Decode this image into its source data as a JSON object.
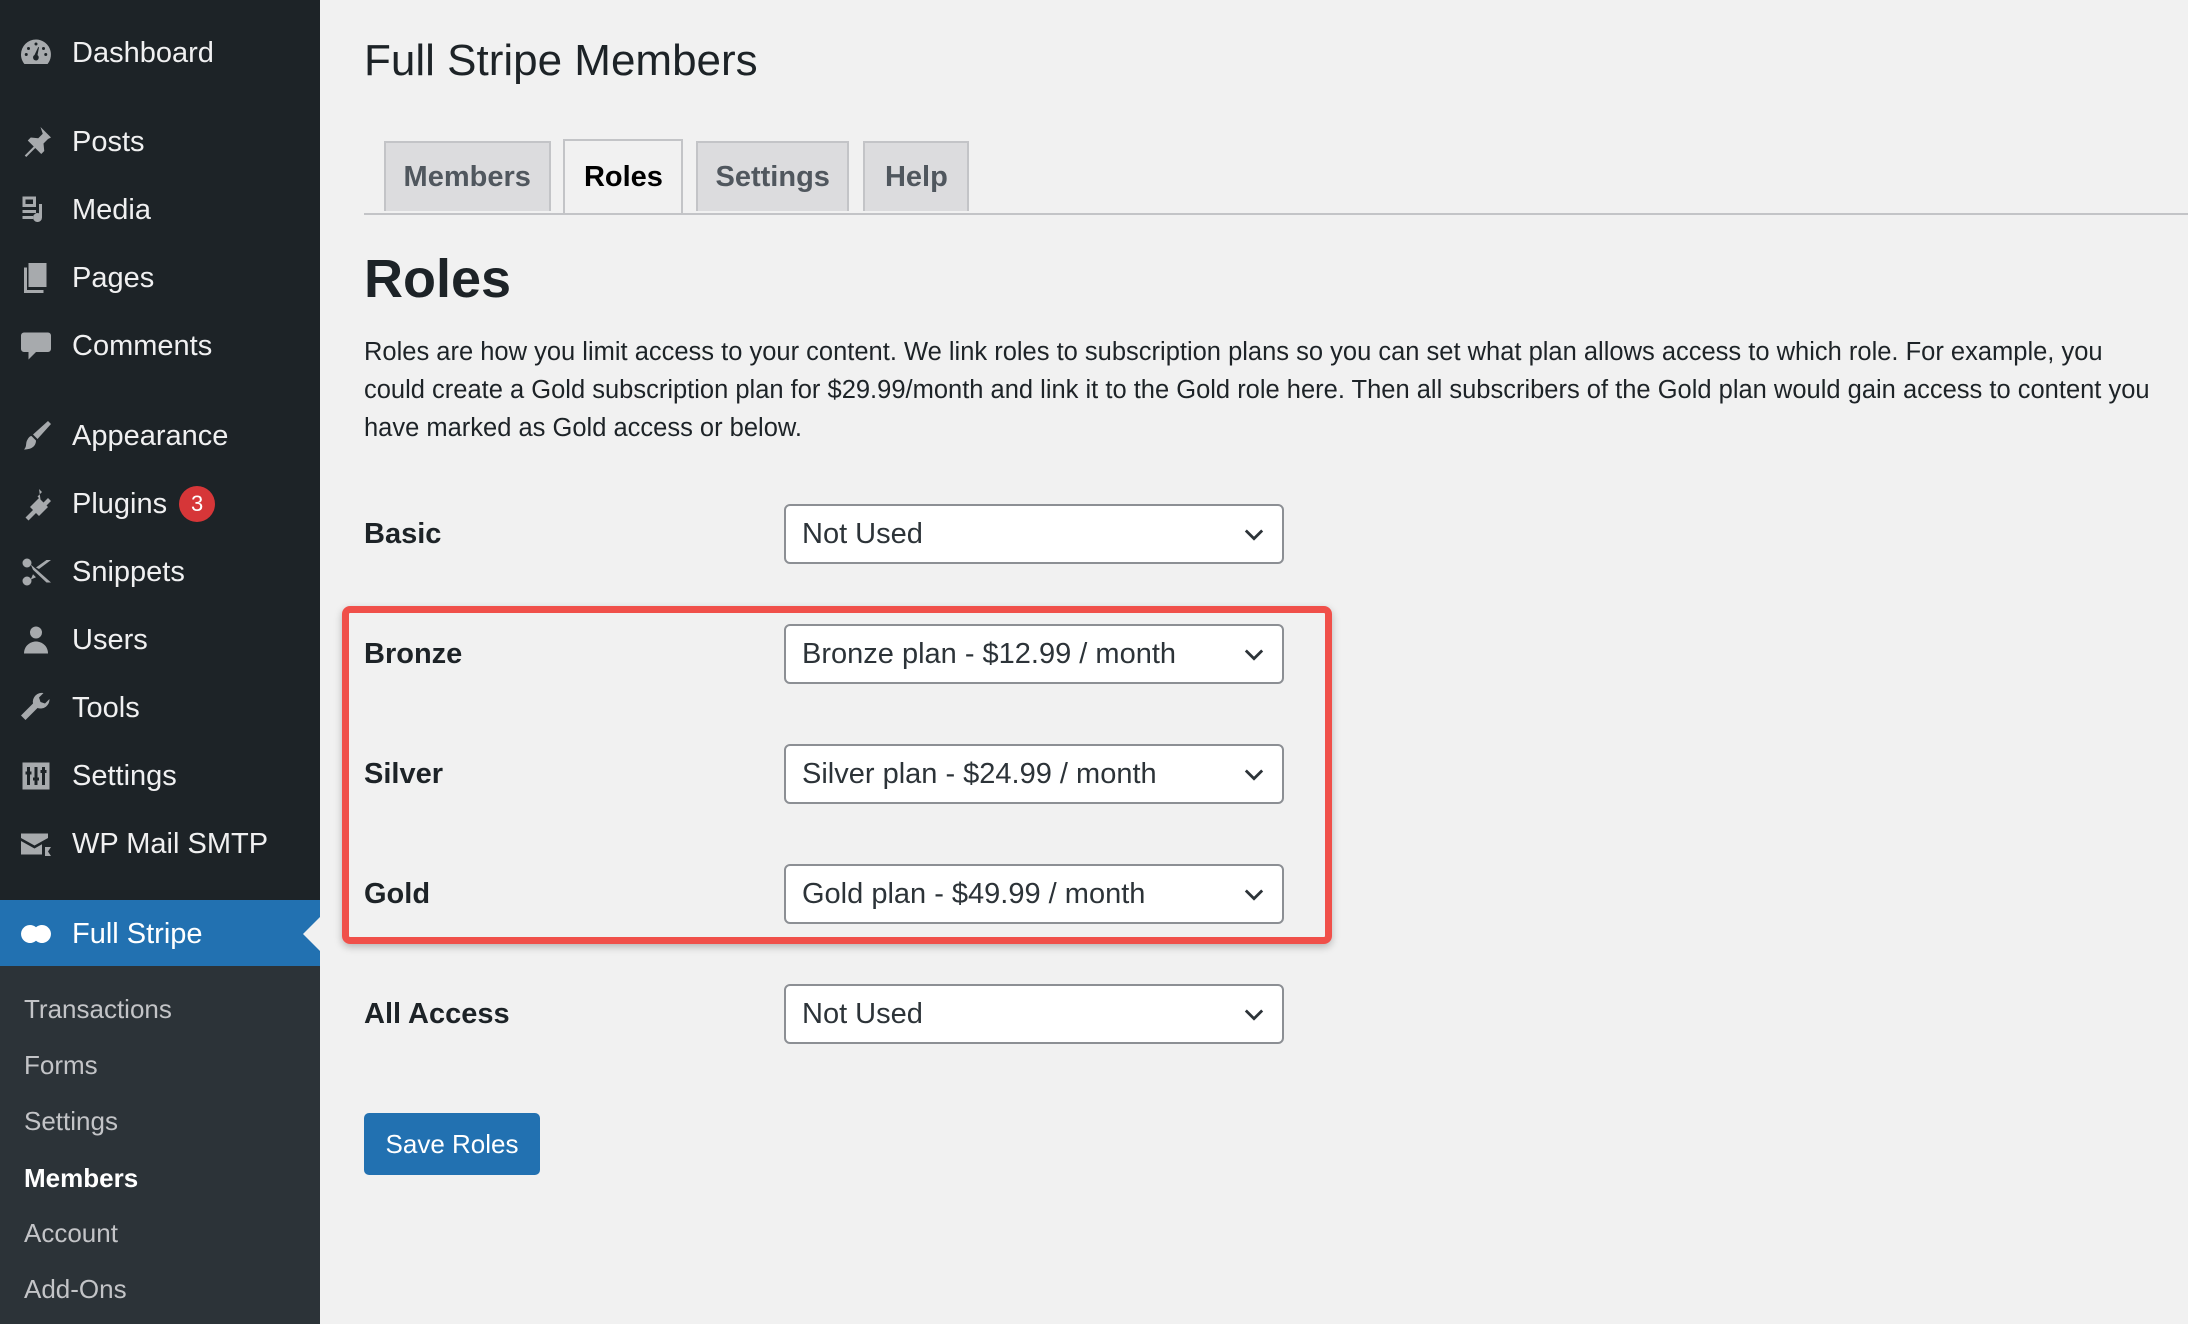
{
  "sidebar": {
    "items": [
      {
        "label": "Dashboard",
        "icon": "dashboard-icon"
      },
      {
        "label": "Posts",
        "icon": "pin-icon"
      },
      {
        "label": "Media",
        "icon": "media-icon"
      },
      {
        "label": "Pages",
        "icon": "pages-icon"
      },
      {
        "label": "Comments",
        "icon": "comment-icon"
      },
      {
        "label": "Appearance",
        "icon": "brush-icon"
      },
      {
        "label": "Plugins",
        "icon": "plug-icon",
        "badge": "3"
      },
      {
        "label": "Snippets",
        "icon": "scissors-icon"
      },
      {
        "label": "Users",
        "icon": "user-icon"
      },
      {
        "label": "Tools",
        "icon": "wrench-icon"
      },
      {
        "label": "Settings",
        "icon": "sliders-icon"
      },
      {
        "label": "WP Mail SMTP",
        "icon": "mail-icon"
      },
      {
        "label": "Full Stripe",
        "icon": "full-stripe-icon"
      }
    ],
    "submenu": [
      {
        "label": "Transactions"
      },
      {
        "label": "Forms"
      },
      {
        "label": "Settings"
      },
      {
        "label": "Members"
      },
      {
        "label": "Account"
      },
      {
        "label": "Add-Ons"
      }
    ]
  },
  "page": {
    "title": "Full Stripe Members",
    "tabs": [
      {
        "label": "Members"
      },
      {
        "label": "Roles"
      },
      {
        "label": "Settings"
      },
      {
        "label": "Help"
      }
    ],
    "section_title": "Roles",
    "description": "Roles are how you limit access to your content. We link roles to subscription plans so you can set what plan allows access to which role. For example, you could create a Gold subscription plan for $29.99/month and link it to the Gold role here. Then all subscribers of the Gold plan would gain access to content you have marked as Gold access or below."
  },
  "roles": [
    {
      "label": "Basic",
      "value": "Not Used"
    },
    {
      "label": "Bronze",
      "value": "Bronze plan - $12.99 / month"
    },
    {
      "label": "Silver",
      "value": "Silver plan - $24.99 / month"
    },
    {
      "label": "Gold",
      "value": "Gold plan - $49.99 / month"
    },
    {
      "label": "All Access",
      "value": "Not Used"
    }
  ],
  "save_label": "Save Roles",
  "colors": {
    "sidebar_bg": "#1d2327",
    "submenu_bg": "#2c3338",
    "accent": "#2271b1",
    "badge": "#d63638",
    "highlight": "#f0504a"
  }
}
